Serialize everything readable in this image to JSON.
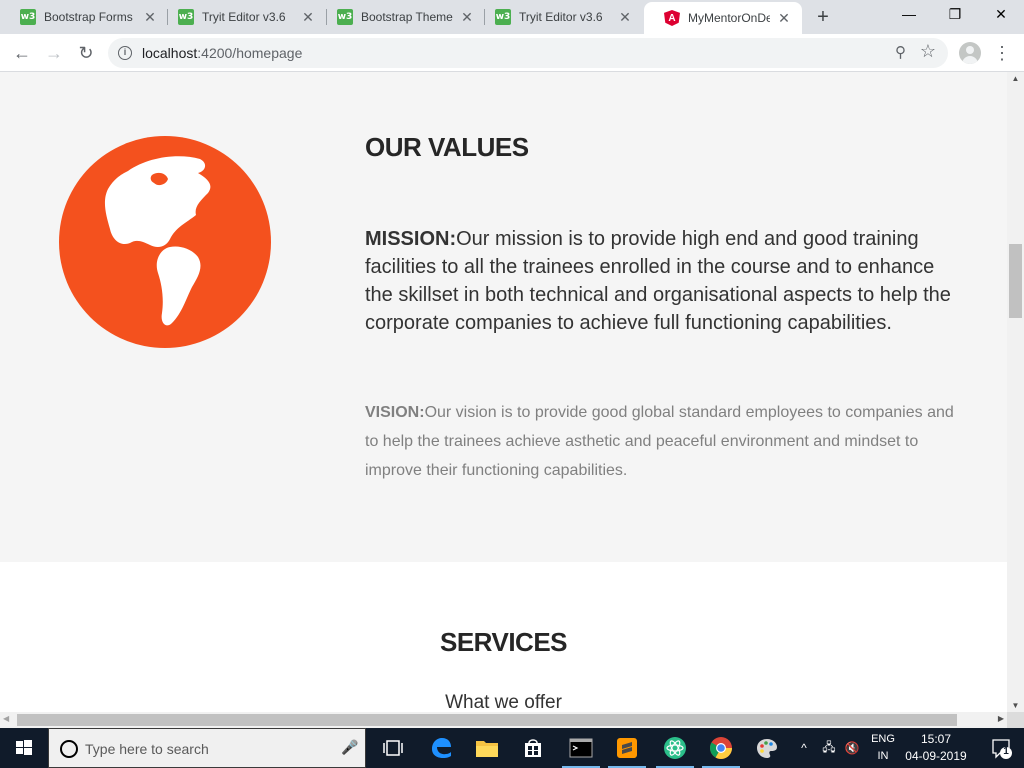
{
  "browser": {
    "tabs": [
      {
        "label": "Bootstrap Forms",
        "icon": "w3schools-icon",
        "active": false
      },
      {
        "label": "Tryit Editor v3.6",
        "icon": "w3schools-icon",
        "active": false
      },
      {
        "label": "Bootstrap Theme",
        "icon": "w3schools-icon",
        "active": false
      },
      {
        "label": "Tryit Editor v3.6",
        "icon": "w3schools-icon",
        "active": false
      },
      {
        "label": "MyMentorOnDem",
        "icon": "angular-icon",
        "active": true
      }
    ],
    "favicon_text": {
      "w3": "w3",
      "angular": "A"
    },
    "new_tab": "+",
    "window_controls": {
      "minimize": "—",
      "restore": "❐",
      "close": "✕"
    },
    "nav": {
      "back": "←",
      "forward": "→",
      "reload": "↻"
    },
    "url": {
      "host": "localhost",
      "path": ":4200/homepage"
    },
    "omnibox_icons": {
      "info": "i",
      "zoom": "⚲",
      "star": "☆"
    },
    "menu": "⋮"
  },
  "page": {
    "values": {
      "title": "OUR VALUES",
      "mission_label": "MISSION:",
      "mission_text": "Our mission is to provide high end and good training facilities to all the trainees enrolled in the course and to enhance the skillset in both technical and organisational aspects to help the corporate companies to achieve full functioning capabilities.",
      "vision_label": "VISION:",
      "vision_text": "Our vision is to provide good global standard employees to companies and to help the trainees achieve asthetic and peaceful environment and mindset to improve their functioning capabilities."
    },
    "services": {
      "title": "SERVICES",
      "subtitle": "What we offer"
    },
    "colors": {
      "globe": "#f4511e",
      "section_bg": "#f5f5f5"
    }
  },
  "scrollbars": {
    "up": "▲",
    "down": "▼",
    "left": "◀",
    "right": "▶"
  },
  "taskbar": {
    "search_placeholder": "Type here to search",
    "mic": "🎤",
    "tray_caret": "^",
    "network": "🖧",
    "volume": "🔇",
    "language_line1": "ENG",
    "language_line2": "IN",
    "time": "15:07",
    "date": "04-09-2019",
    "notification_count": "1"
  }
}
